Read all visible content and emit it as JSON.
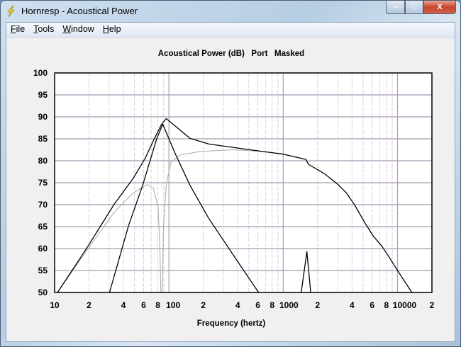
{
  "window": {
    "title": "Hornresp - Acoustical Power",
    "minimize": "‒",
    "maximize": "□",
    "close": "X"
  },
  "menu": [
    {
      "key": "F",
      "rest": "ile"
    },
    {
      "key": "T",
      "rest": "ools"
    },
    {
      "key": "W",
      "rest": "indow"
    },
    {
      "key": "H",
      "rest": "elp"
    }
  ],
  "colors": {
    "total": "#000000",
    "port": "#000000",
    "driver": "#a8a8a8",
    "hgrid": "#a898b0",
    "major_vgrid": "#a0a8a0"
  },
  "chart_data": {
    "type": "line",
    "title": "Acoustical Power (dB)   Port   Masked",
    "xlabel": "Frequency (hertz)",
    "ylabel": "",
    "xscale": "log",
    "xlim": [
      10,
      20000
    ],
    "ylim": [
      50,
      100
    ],
    "grid": true,
    "yticks": [
      50,
      55,
      60,
      65,
      70,
      75,
      80,
      85,
      90,
      95,
      100
    ],
    "xticks": [
      {
        "v": 10,
        "label": "10"
      },
      {
        "v": 20,
        "label": "2"
      },
      {
        "v": 40,
        "label": "4"
      },
      {
        "v": 60,
        "label": "6"
      },
      {
        "v": 80,
        "label": "8"
      },
      {
        "v": 100,
        "label": "100"
      },
      {
        "v": 200,
        "label": "2"
      },
      {
        "v": 400,
        "label": "4"
      },
      {
        "v": 600,
        "label": "6"
      },
      {
        "v": 800,
        "label": "8"
      },
      {
        "v": 1000,
        "label": "1000"
      },
      {
        "v": 2000,
        "label": "2"
      },
      {
        "v": 4000,
        "label": "4"
      },
      {
        "v": 6000,
        "label": "6"
      },
      {
        "v": 8000,
        "label": "8"
      },
      {
        "v": 10000,
        "label": "10000"
      },
      {
        "v": 20000,
        "label": "2"
      }
    ],
    "series": [
      {
        "name": "total",
        "color": "#000000",
        "points": [
          [
            10.6,
            50
          ],
          [
            18.8,
            59.8
          ],
          [
            33,
            70
          ],
          [
            48.7,
            76
          ],
          [
            61.8,
            80.5
          ],
          [
            74.8,
            85.1
          ],
          [
            86.3,
            88.3
          ],
          [
            94.9,
            89.6
          ],
          [
            115,
            87.8
          ],
          [
            153,
            85.1
          ],
          [
            224,
            83.8
          ],
          [
            396,
            82.9
          ],
          [
            670,
            82.1
          ],
          [
            1000,
            81.5
          ],
          [
            1580,
            80.3
          ],
          [
            1660,
            79.2
          ],
          [
            2310,
            77.0
          ],
          [
            3010,
            74.6
          ],
          [
            3560,
            72.7
          ],
          [
            4200,
            70.0
          ],
          [
            5200,
            65.8
          ],
          [
            6150,
            62.8
          ],
          [
            7270,
            60.6
          ],
          [
            8380,
            58.2
          ],
          [
            10000,
            55
          ],
          [
            13370,
            50
          ]
        ]
      },
      {
        "name": "port",
        "color": "#000000",
        "points": [
          [
            30.2,
            50
          ],
          [
            44.3,
            65.2
          ],
          [
            58.9,
            74.4
          ],
          [
            78.4,
            85.1
          ],
          [
            88.3,
            88.3
          ],
          [
            115,
            81.3
          ],
          [
            153,
            74.4
          ],
          [
            224,
            66.8
          ],
          [
            360,
            58.8
          ],
          [
            609,
            50
          ]
        ]
      },
      {
        "name": "port-spike",
        "color": "#000000",
        "points": [
          [
            1436,
            50
          ],
          [
            1610,
            59.3
          ],
          [
            1740,
            50
          ]
        ]
      },
      {
        "name": "driver",
        "color": "#a8a8a8",
        "points": [
          [
            10.6,
            50
          ],
          [
            18.8,
            59.3
          ],
          [
            33,
            68.2
          ],
          [
            48.7,
            72.7
          ],
          [
            64.7,
            74.6
          ],
          [
            73,
            73.8
          ],
          [
            80.4,
            69.5
          ],
          [
            83.4,
            59.8
          ],
          [
            85,
            50
          ],
          [
            87.5,
            50
          ],
          [
            89.6,
            65.2
          ],
          [
            95,
            74.9
          ],
          [
            104.4,
            79.7
          ],
          [
            126,
            81.3
          ],
          [
            185,
            82.1
          ],
          [
            360,
            82.5
          ],
          [
            500,
            82.3
          ],
          [
            670,
            82.1
          ],
          [
            1000,
            81.5
          ],
          [
            1580,
            80.3
          ]
        ]
      }
    ]
  }
}
